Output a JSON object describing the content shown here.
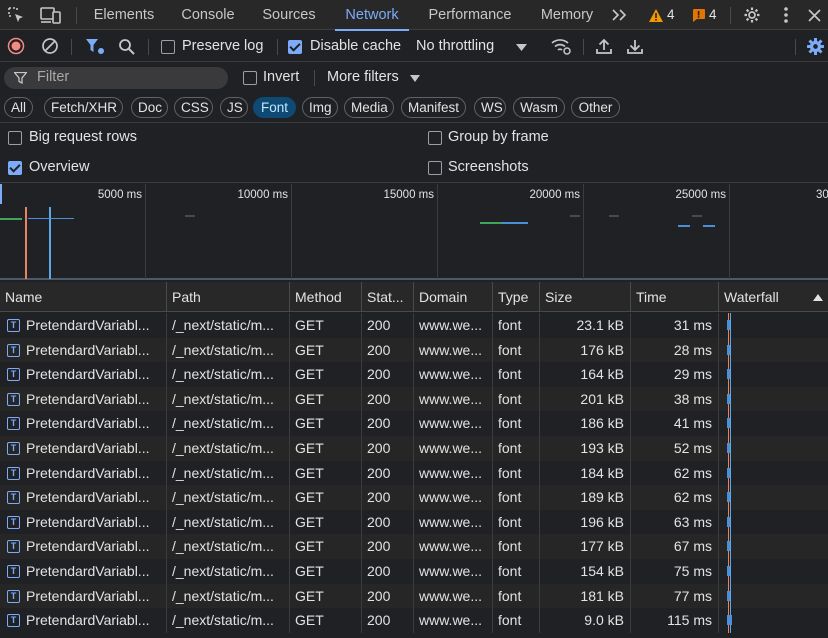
{
  "tabs": [
    {
      "label": "Elements",
      "active": false
    },
    {
      "label": "Console",
      "active": false
    },
    {
      "label": "Sources",
      "active": false
    },
    {
      "label": "Network",
      "active": true
    },
    {
      "label": "Performance",
      "active": false
    },
    {
      "label": "Memory",
      "active": false
    }
  ],
  "badges": {
    "warnings": "4",
    "issues": "4"
  },
  "toolbar": {
    "preserve_log_label": "Preserve log",
    "preserve_log_checked": false,
    "disable_cache_label": "Disable cache",
    "disable_cache_checked": true,
    "throttling": "No throttling"
  },
  "filter": {
    "placeholder": "Filter",
    "invert_label": "Invert",
    "more_filters_label": "More filters"
  },
  "type_filters": [
    {
      "label": "All",
      "active": false
    },
    {
      "label": "Fetch/XHR",
      "active": false
    },
    {
      "label": "Doc",
      "active": false
    },
    {
      "label": "CSS",
      "active": false
    },
    {
      "label": "JS",
      "active": false
    },
    {
      "label": "Font",
      "active": true
    },
    {
      "label": "Img",
      "active": false
    },
    {
      "label": "Media",
      "active": false
    },
    {
      "label": "Manifest",
      "active": false
    },
    {
      "label": "WS",
      "active": false
    },
    {
      "label": "Wasm",
      "active": false
    },
    {
      "label": "Other",
      "active": false
    }
  ],
  "settings": {
    "big_request_rows": {
      "label": "Big request rows",
      "checked": false
    },
    "group_by_frame": {
      "label": "Group by frame",
      "checked": false
    },
    "overview": {
      "label": "Overview",
      "checked": true
    },
    "screenshots": {
      "label": "Screenshots",
      "checked": false
    }
  },
  "overview_ticks": [
    "5000 ms",
    "10000 ms",
    "15000 ms",
    "20000 ms",
    "25000 ms",
    "30"
  ],
  "columns": [
    "Name",
    "Path",
    "Method",
    "Stat...",
    "Domain",
    "Type",
    "Size",
    "Time",
    "Waterfall"
  ],
  "rows": [
    {
      "name": "PretendardVariabl...",
      "path": "/_next/static/m...",
      "method": "GET",
      "status": "200",
      "domain": "www.we...",
      "type": "font",
      "size": "23.1 kB",
      "time": "31 ms"
    },
    {
      "name": "PretendardVariabl...",
      "path": "/_next/static/m...",
      "method": "GET",
      "status": "200",
      "domain": "www.we...",
      "type": "font",
      "size": "176 kB",
      "time": "28 ms"
    },
    {
      "name": "PretendardVariabl...",
      "path": "/_next/static/m...",
      "method": "GET",
      "status": "200",
      "domain": "www.we...",
      "type": "font",
      "size": "164 kB",
      "time": "29 ms"
    },
    {
      "name": "PretendardVariabl...",
      "path": "/_next/static/m...",
      "method": "GET",
      "status": "200",
      "domain": "www.we...",
      "type": "font",
      "size": "201 kB",
      "time": "38 ms"
    },
    {
      "name": "PretendardVariabl...",
      "path": "/_next/static/m...",
      "method": "GET",
      "status": "200",
      "domain": "www.we...",
      "type": "font",
      "size": "186 kB",
      "time": "41 ms"
    },
    {
      "name": "PretendardVariabl...",
      "path": "/_next/static/m...",
      "method": "GET",
      "status": "200",
      "domain": "www.we...",
      "type": "font",
      "size": "193 kB",
      "time": "52 ms"
    },
    {
      "name": "PretendardVariabl...",
      "path": "/_next/static/m...",
      "method": "GET",
      "status": "200",
      "domain": "www.we...",
      "type": "font",
      "size": "184 kB",
      "time": "62 ms"
    },
    {
      "name": "PretendardVariabl...",
      "path": "/_next/static/m...",
      "method": "GET",
      "status": "200",
      "domain": "www.we...",
      "type": "font",
      "size": "189 kB",
      "time": "62 ms"
    },
    {
      "name": "PretendardVariabl...",
      "path": "/_next/static/m...",
      "method": "GET",
      "status": "200",
      "domain": "www.we...",
      "type": "font",
      "size": "196 kB",
      "time": "63 ms"
    },
    {
      "name": "PretendardVariabl...",
      "path": "/_next/static/m...",
      "method": "GET",
      "status": "200",
      "domain": "www.we...",
      "type": "font",
      "size": "177 kB",
      "time": "67 ms"
    },
    {
      "name": "PretendardVariabl...",
      "path": "/_next/static/m...",
      "method": "GET",
      "status": "200",
      "domain": "www.we...",
      "type": "font",
      "size": "154 kB",
      "time": "75 ms"
    },
    {
      "name": "PretendardVariabl...",
      "path": "/_next/static/m...",
      "method": "GET",
      "status": "200",
      "domain": "www.we...",
      "type": "font",
      "size": "181 kB",
      "time": "77 ms"
    },
    {
      "name": "PretendardVariabl...",
      "path": "/_next/static/m...",
      "method": "GET",
      "status": "200",
      "domain": "www.we...",
      "type": "font",
      "size": "9.0 kB",
      "time": "115 ms"
    }
  ],
  "colors": {
    "accent": "#7cacf8",
    "warning": "#f29900",
    "issue": "#e37400",
    "record": "#f28b82"
  }
}
